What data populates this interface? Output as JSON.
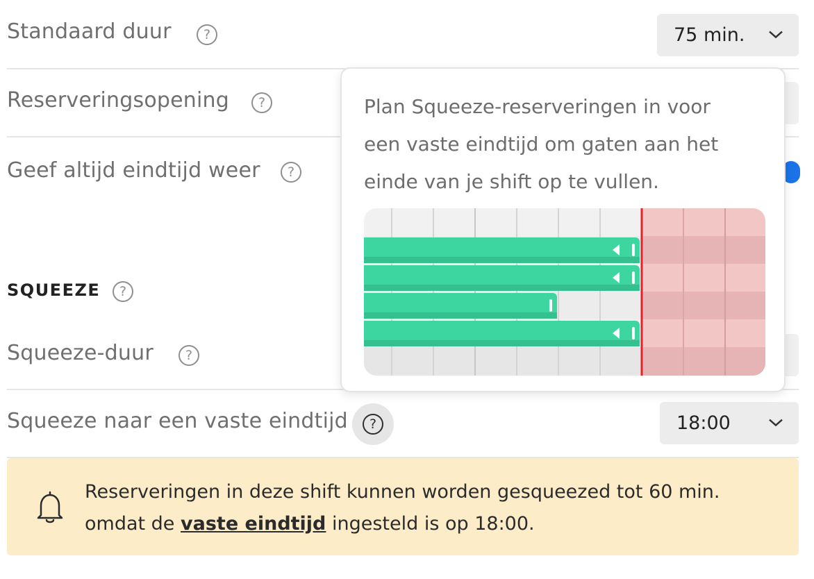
{
  "settings": {
    "default_duration": {
      "label": "Standaard duur",
      "value": "75 min."
    },
    "booking_opening": {
      "label": "Reserveringsopening"
    },
    "always_show_end": {
      "label": "Geef altijd eindtijd weer"
    },
    "section_title": "SQUEEZE",
    "squeeze_duration": {
      "label": "Squeeze-duur"
    },
    "squeeze_fixed_end": {
      "label": "Squeeze naar een vaste eindtijd",
      "value": "18:00"
    }
  },
  "help_glyph": "?",
  "tooltip": {
    "text": "Plan Squeeze-reserveringen in voor een vaste eindtijd om gaten aan het einde van je shift op te vullen."
  },
  "alert": {
    "line1": "Reserveringen in deze shift kunnen worden gesqueezed tot 60 min.",
    "line2_prefix": "omdat de ",
    "link": "vaste eindtijd",
    "line2_suffix": " ingesteld is op 18:00."
  },
  "icons": {
    "help": "question-circle-icon",
    "chevron": "chevron-down-icon",
    "bell": "bell-icon"
  },
  "colors": {
    "accent": "#1a73e8",
    "bar_green": "#3ed6a0",
    "cutoff_red": "#e5202f",
    "overflow_pink": "#f2c4c4",
    "alert_bg": "#fdecc8"
  }
}
